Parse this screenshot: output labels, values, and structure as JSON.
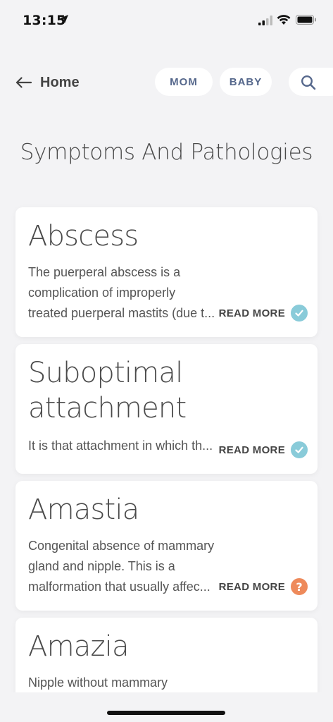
{
  "status_bar": {
    "time": "13:15"
  },
  "nav": {
    "back_label": "Home",
    "tabs": [
      "MOM",
      "BABY"
    ]
  },
  "page": {
    "title": "Symptoms And Pathologies"
  },
  "cards": [
    {
      "title": "Abscess",
      "description": "The puerperal abscess is a\ncomplication of improperly\ntreated puerperal mastits (due t...",
      "read_more": "READ MORE",
      "status": "done"
    },
    {
      "title": "Suboptimal\nattachment",
      "description": "It is that attachment in which th...",
      "read_more": "READ MORE",
      "status": "done"
    },
    {
      "title": "Amastia",
      "description": "Congenital absence of mammary\ngland and nipple. This is a\nmalformation that usually affec...",
      "read_more": "READ MORE",
      "status": "unknown"
    },
    {
      "title": "Amazia",
      "description": "Nipple without mammary",
      "read_more": "",
      "status": ""
    }
  ],
  "colors": {
    "check": "#89cbd9",
    "question": "#ee8a5b",
    "pill_text": "#56688c"
  },
  "icons": {
    "done": "checkmark-icon",
    "unknown": "question-icon"
  }
}
